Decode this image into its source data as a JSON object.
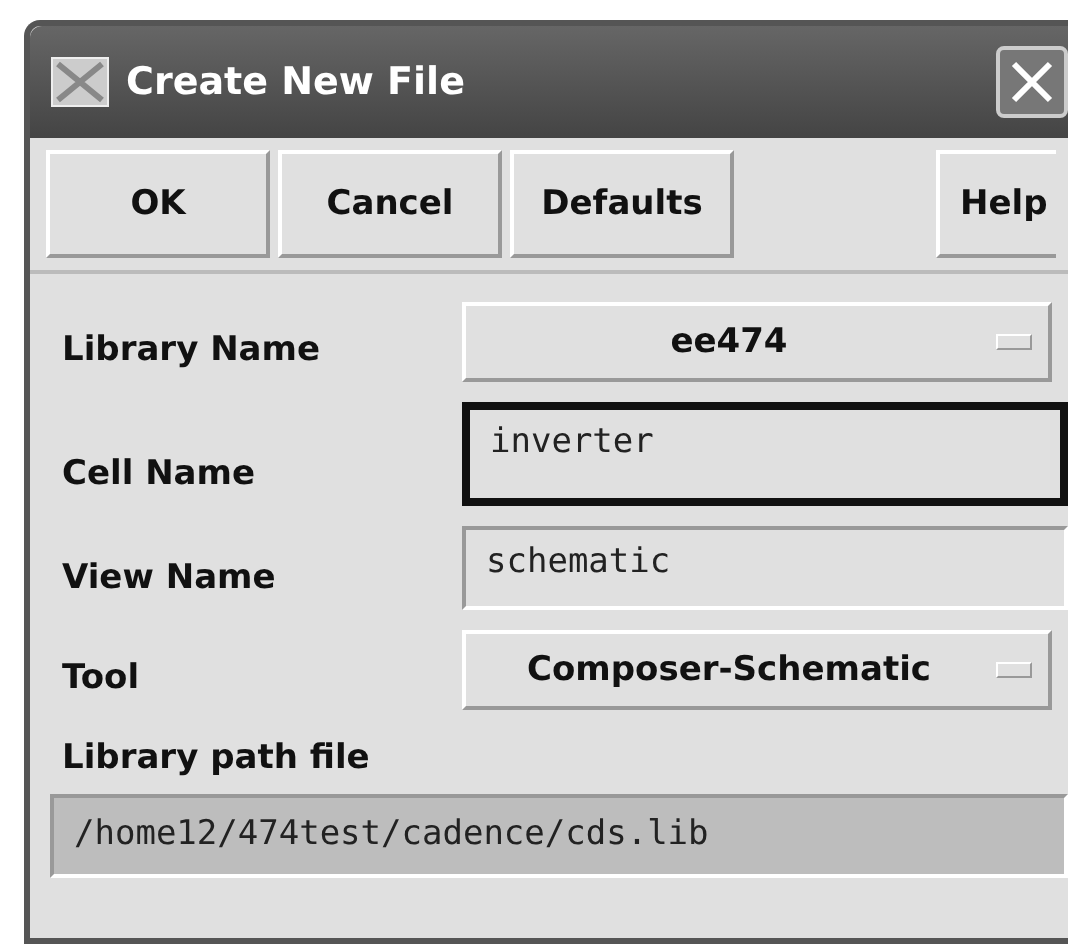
{
  "window": {
    "title": "Create New File"
  },
  "buttons": [
    {
      "label": "OK"
    },
    {
      "label": "Cancel"
    },
    {
      "label": "Defaults"
    },
    {
      "label": "Help"
    }
  ],
  "fields": [
    {
      "kind": "dropdown",
      "label": "Library Name",
      "value": "ee474",
      "focused": false
    },
    {
      "kind": "text",
      "label": "Cell Name",
      "value": "inverter",
      "focused": true
    },
    {
      "kind": "text",
      "label": "View Name",
      "value": "schematic",
      "focused": false
    },
    {
      "kind": "dropdown",
      "label": "Tool",
      "value": "Composer-Schematic",
      "focused": false
    }
  ],
  "path": {
    "label": "Library path file",
    "value": "/home12/474test/cadence/cds.lib",
    "disabled": true
  }
}
